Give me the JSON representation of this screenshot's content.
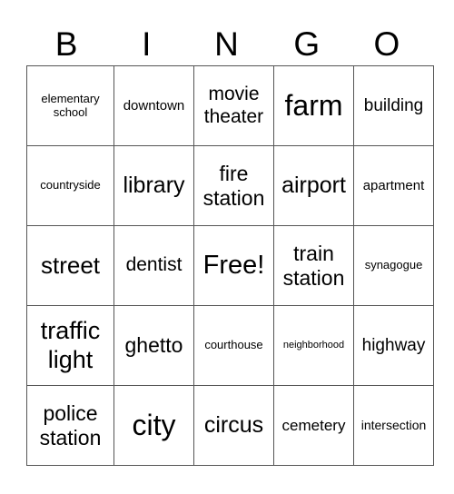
{
  "header": [
    "B",
    "I",
    "N",
    "G",
    "O"
  ],
  "cells": [
    [
      "elementary school",
      "downtown",
      "movie theater",
      "farm",
      "building"
    ],
    [
      "countryside",
      "library",
      "fire station",
      "airport",
      "apartment"
    ],
    [
      "street",
      "dentist",
      "Free!",
      "train station",
      "synagogue"
    ],
    [
      "traffic light",
      "ghetto",
      "courthouse",
      "neighborhood",
      "highway"
    ],
    [
      "police station",
      "city",
      "circus",
      "cemetery",
      "intersection"
    ]
  ]
}
